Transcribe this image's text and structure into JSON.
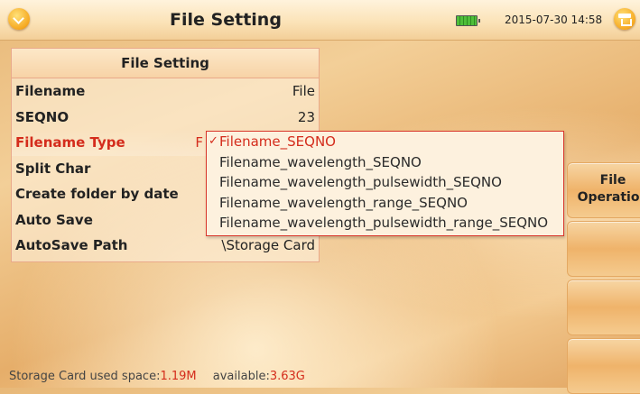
{
  "header": {
    "title": "File Setting",
    "datetime": "2015-07-30 14:58",
    "menu_icon": "chevron-down-circle-icon",
    "home_icon": "home-icon",
    "battery_icon": "battery-icon"
  },
  "panel": {
    "title": "File Setting",
    "rows": [
      {
        "label": "Filename",
        "value": "File"
      },
      {
        "label": "SEQNO",
        "value": "23"
      },
      {
        "label": "Filename Type",
        "value": "F"
      },
      {
        "label": "Split Char",
        "value": ""
      },
      {
        "label": "Create folder by date",
        "value": ""
      },
      {
        "label": "Auto Save",
        "value": ""
      },
      {
        "label": "AutoSave Path",
        "value": "\\Storage Card"
      }
    ]
  },
  "dropdown": {
    "check_mark": "✓",
    "options": [
      "Filename_SEQNO",
      "Filename_wavelength_SEQNO",
      "Filename_wavelength_pulsewidth_SEQNO",
      "Filename_wavelength_range_SEQNO",
      "Filename_wavelength_pulsewidth_range_SEQNO"
    ],
    "selected": "Filename_SEQNO"
  },
  "side_buttons": {
    "file_operation": "File Operation"
  },
  "status": {
    "used_label": "Storage Card used space:",
    "used_value": "1.19M",
    "available_label": "available:",
    "available_value": "3.63G"
  },
  "colors": {
    "accent_red": "#d42c1c",
    "background_orange": "#f3cf98"
  }
}
